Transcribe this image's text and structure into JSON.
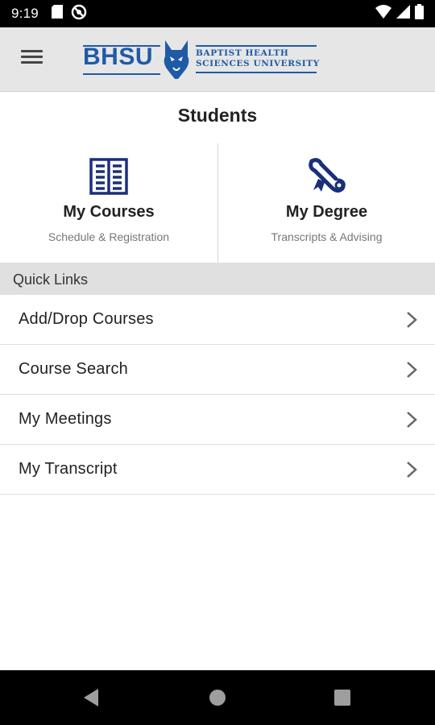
{
  "status_bar": {
    "time": "9:19",
    "left_icons": [
      "sd-card-icon",
      "sync-blocked-icon"
    ],
    "right_icons": [
      "wifi-icon",
      "signal-icon",
      "battery-icon"
    ]
  },
  "app_bar": {
    "logo_text": "BHSU",
    "logo_line1": "BAPTIST HEALTH",
    "logo_line2": "SCIENCES UNIVERSITY",
    "brand_color": "#1f5aa6"
  },
  "section_title": "Students",
  "tiles": [
    {
      "title": "My Courses",
      "subtitle": "Schedule & Registration",
      "icon": "open-book-icon"
    },
    {
      "title": "My Degree",
      "subtitle": "Transcripts & Advising",
      "icon": "diploma-scroll-icon"
    }
  ],
  "quick_links": {
    "header": "Quick Links",
    "items": [
      {
        "label": "Add/Drop Courses"
      },
      {
        "label": "Course Search"
      },
      {
        "label": "My Meetings"
      },
      {
        "label": "My Transcript"
      }
    ]
  },
  "nav_bar": {
    "buttons": [
      "back-icon",
      "home-icon",
      "recents-icon"
    ]
  },
  "colors": {
    "icon_navy": "#1a2f7a",
    "app_bar_bg": "#e6e6e6",
    "section_header_bg": "#e0e0e0"
  }
}
